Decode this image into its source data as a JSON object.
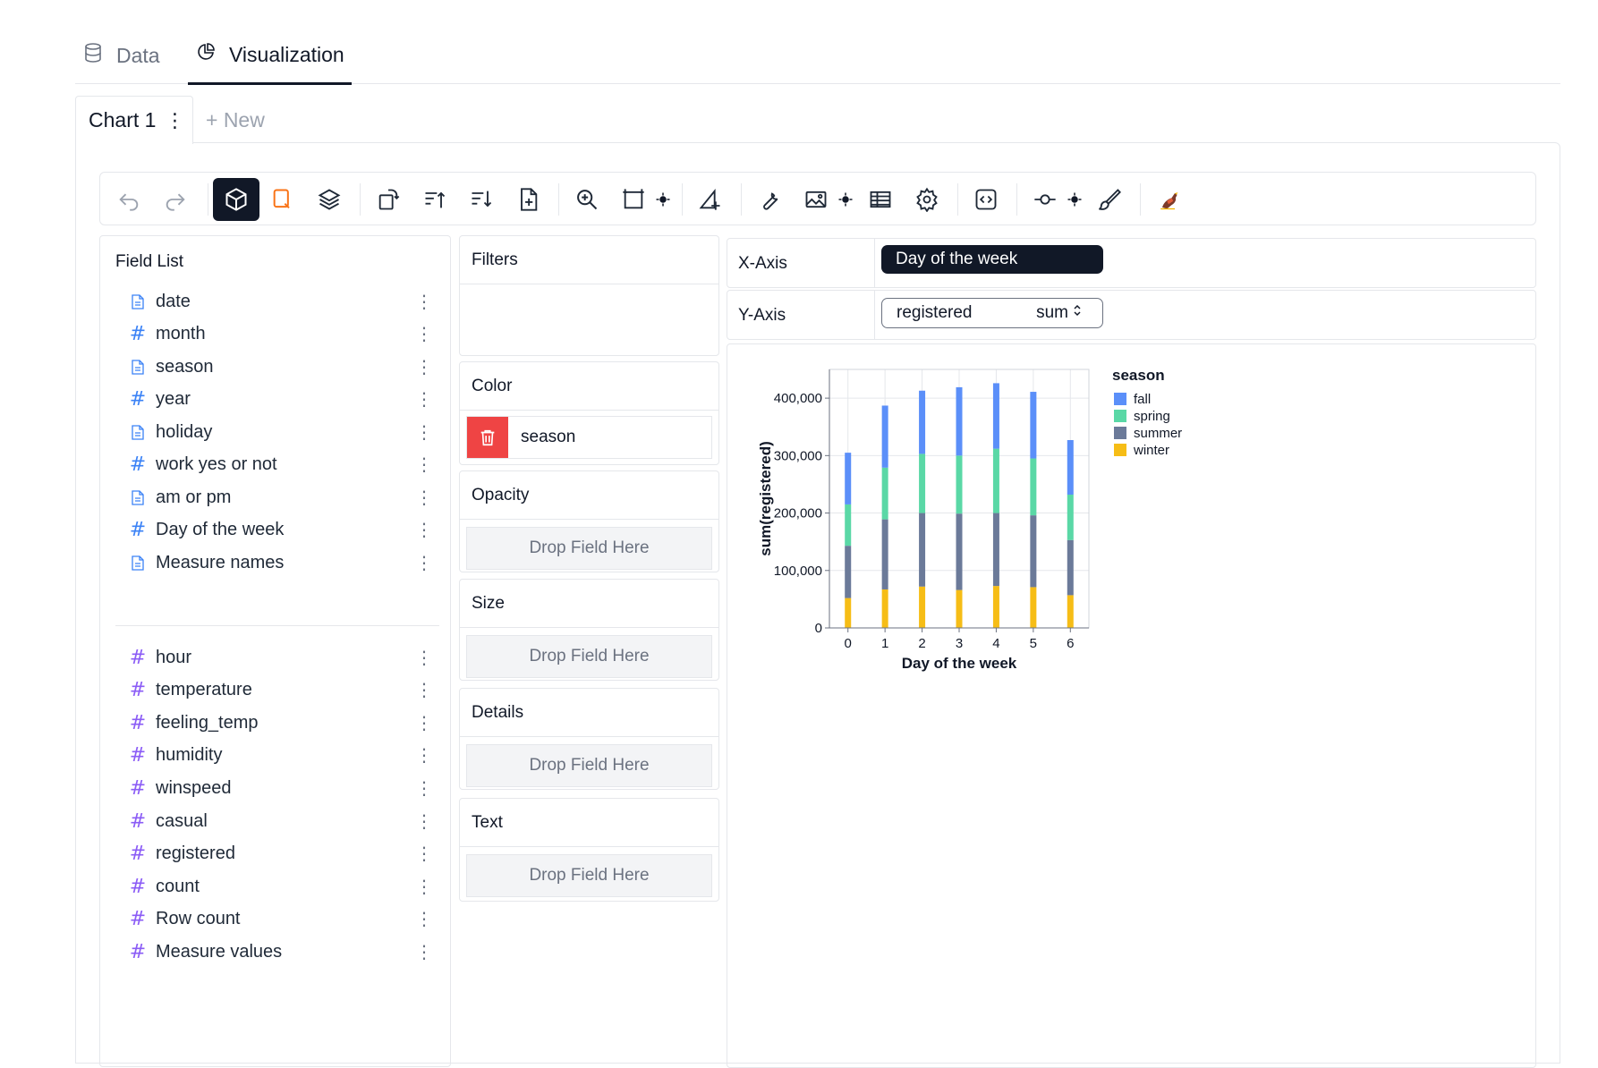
{
  "top_tabs": [
    {
      "label": "Data",
      "icon": "database-icon"
    },
    {
      "label": "Visualization",
      "icon": "pie-chart-icon"
    }
  ],
  "chart_tabs": {
    "active": "Chart 1",
    "new_label": "+ New"
  },
  "toolbar": {
    "buttons": [
      "undo-icon",
      "redo-icon",
      "cube-icon",
      "brush-select-icon",
      "layers-icon",
      "transpose-icon",
      "sort-ascending-icon",
      "sort-descending-icon",
      "add-file-icon",
      "zoom-icon",
      "resize-icon",
      "triangle-icon",
      "wrench-icon",
      "image-icon",
      "table-icon",
      "settings-icon",
      "code-icon",
      "slider-icon",
      "paint-brush-icon",
      "bird-logo-icon"
    ]
  },
  "field_list": {
    "title": "Field List",
    "dimensions": [
      {
        "name": "date",
        "type": "doc"
      },
      {
        "name": "month",
        "type": "hash"
      },
      {
        "name": "season",
        "type": "doc"
      },
      {
        "name": "year",
        "type": "hash"
      },
      {
        "name": "holiday",
        "type": "doc"
      },
      {
        "name": "work yes or not",
        "type": "hash"
      },
      {
        "name": "am or pm",
        "type": "doc"
      },
      {
        "name": "Day of the week",
        "type": "hash"
      },
      {
        "name": "Measure names",
        "type": "doc"
      }
    ],
    "measures": [
      {
        "name": "hour"
      },
      {
        "name": "temperature"
      },
      {
        "name": "feeling_temp"
      },
      {
        "name": "humidity"
      },
      {
        "name": "winspeed"
      },
      {
        "name": "casual"
      },
      {
        "name": "registered"
      },
      {
        "name": "count"
      },
      {
        "name": "Row count"
      },
      {
        "name": "Measure values"
      }
    ]
  },
  "encodings": {
    "filters": "Filters",
    "color": {
      "label": "Color",
      "field": "season"
    },
    "opacity": "Opacity",
    "size": "Size",
    "details": "Details",
    "text": "Text",
    "drop_placeholder": "Drop Field Here"
  },
  "axes": {
    "x_label": "X-Axis",
    "x_field": "Day of the week",
    "y_label": "Y-Axis",
    "y_field": "registered",
    "y_agg": "sum"
  },
  "colors": {
    "fall": "#5b8ff9",
    "spring": "#5ad8a6",
    "summer": "#6b7a99",
    "winter": "#f6bd16"
  },
  "chart_data": {
    "type": "bar",
    "stacked": true,
    "xlabel": "Day of the week",
    "ylabel": "sum(registered)",
    "ylim": [
      0,
      450000
    ],
    "yticks": [
      0,
      100000,
      200000,
      300000,
      400000
    ],
    "ytick_labels": [
      "0",
      "100,000",
      "200,000",
      "300,000",
      "400,000"
    ],
    "categories": [
      "0",
      "1",
      "2",
      "3",
      "4",
      "5",
      "6"
    ],
    "legend_title": "season",
    "legend_position": "right",
    "grid": true,
    "series": [
      {
        "name": "winter",
        "values": [
          52000,
          67000,
          72000,
          66000,
          73000,
          71000,
          57000
        ]
      },
      {
        "name": "summer",
        "values": [
          91000,
          122000,
          128000,
          133000,
          127000,
          125000,
          96000
        ]
      },
      {
        "name": "spring",
        "values": [
          72000,
          90000,
          103000,
          101000,
          112000,
          99000,
          79000
        ]
      },
      {
        "name": "fall",
        "values": [
          90000,
          108000,
          110000,
          119000,
          114000,
          116000,
          95000
        ]
      }
    ],
    "legend_order": [
      "fall",
      "spring",
      "summer",
      "winter"
    ]
  }
}
